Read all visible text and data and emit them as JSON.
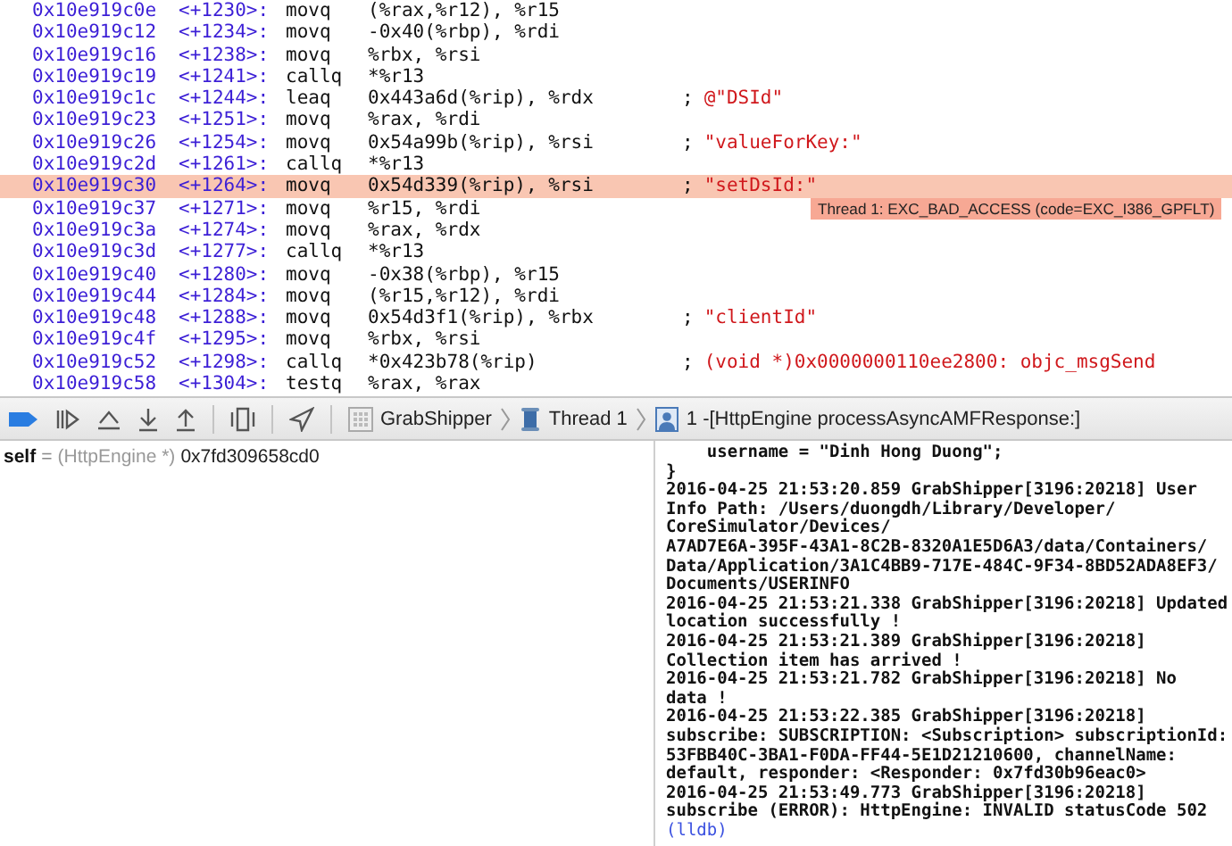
{
  "disassembly": {
    "rows": [
      {
        "address": "0x10e919c0e",
        "offset": "<+1230>:",
        "mnemonic": "movq",
        "operands": "(%rax,%r12), %r15",
        "current": false
      },
      {
        "address": "0x10e919c12",
        "offset": "<+1234>:",
        "mnemonic": "movq",
        "operands": "-0x40(%rbp), %rdi",
        "current": false
      },
      {
        "address": "0x10e919c16",
        "offset": "<+1238>:",
        "mnemonic": "movq",
        "operands": "%rbx, %rsi",
        "current": false
      },
      {
        "address": "0x10e919c19",
        "offset": "<+1241>:",
        "mnemonic": "callq",
        "operands": "*%r13",
        "current": false
      },
      {
        "address": "0x10e919c1c",
        "offset": "<+1244>:",
        "mnemonic": "leaq",
        "operands": "0x443a6d(%rip), %rdx",
        "comment_marker": ";",
        "comment": "@\"DSId\"",
        "current": false
      },
      {
        "address": "0x10e919c23",
        "offset": "<+1251>:",
        "mnemonic": "movq",
        "operands": "%rax, %rdi",
        "current": false
      },
      {
        "address": "0x10e919c26",
        "offset": "<+1254>:",
        "mnemonic": "movq",
        "operands": "0x54a99b(%rip), %rsi",
        "comment_marker": ";",
        "comment": "\"valueForKey:\"",
        "current": false
      },
      {
        "address": "0x10e919c2d",
        "offset": "<+1261>:",
        "mnemonic": "callq",
        "operands": "*%r13",
        "current": false
      },
      {
        "address": "0x10e919c30",
        "offset": "<+1264>:",
        "mnemonic": "movq",
        "operands": "0x54d339(%rip), %rsi",
        "comment_marker": ";",
        "comment": "\"setDsId:\"",
        "current": true,
        "crash_badge": "Thread 1: EXC_BAD_ACCESS (code=EXC_I386_GPFLT)"
      },
      {
        "address": "0x10e919c37",
        "offset": "<+1271>:",
        "mnemonic": "movq",
        "operands": "%r15, %rdi",
        "current": false
      },
      {
        "address": "0x10e919c3a",
        "offset": "<+1274>:",
        "mnemonic": "movq",
        "operands": "%rax, %rdx",
        "current": false
      },
      {
        "address": "0x10e919c3d",
        "offset": "<+1277>:",
        "mnemonic": "callq",
        "operands": "*%r13",
        "current": false
      },
      {
        "address": "0x10e919c40",
        "offset": "<+1280>:",
        "mnemonic": "movq",
        "operands": "-0x38(%rbp), %r15",
        "current": false
      },
      {
        "address": "0x10e919c44",
        "offset": "<+1284>:",
        "mnemonic": "movq",
        "operands": "(%r15,%r12), %rdi",
        "current": false
      },
      {
        "address": "0x10e919c48",
        "offset": "<+1288>:",
        "mnemonic": "movq",
        "operands": "0x54d3f1(%rip), %rbx",
        "comment_marker": ";",
        "comment": "\"clientId\"",
        "current": false
      },
      {
        "address": "0x10e919c4f",
        "offset": "<+1295>:",
        "mnemonic": "movq",
        "operands": "%rbx, %rsi",
        "current": false
      },
      {
        "address": "0x10e919c52",
        "offset": "<+1298>:",
        "mnemonic": "callq",
        "operands": "*0x423b78(%rip)",
        "comment_marker": ";",
        "comment": "(void *)0x0000000110ee2800: objc_msgSend",
        "current": false
      },
      {
        "address": "0x10e919c58",
        "offset": "<+1304>:",
        "mnemonic": "testq",
        "operands": "%rax, %rax",
        "current": false
      }
    ]
  },
  "debug_bar": {
    "breakpoints_active": true,
    "breadcrumb": [
      {
        "kind": "app",
        "label": "GrabShipper"
      },
      {
        "kind": "thread",
        "label": "Thread 1"
      },
      {
        "kind": "frame",
        "label": "1 -[HttpEngine processAsyncAMFResponse:]"
      }
    ]
  },
  "variables": [
    {
      "name": "self",
      "separator": "=",
      "type": "(HttpEngine *)",
      "value": "0x7fd309658cd0"
    }
  ],
  "console": {
    "lines": [
      {
        "kind": "output",
        "text": "    username = \"Dinh Hong Duong\";"
      },
      {
        "kind": "output",
        "text": "}"
      },
      {
        "kind": "output",
        "text": "2016-04-25 21:53:20.859 GrabShipper[3196:20218] User"
      },
      {
        "kind": "output",
        "text": "Info Path: /Users/duongdh/Library/Developer/"
      },
      {
        "kind": "output",
        "text": "CoreSimulator/Devices/"
      },
      {
        "kind": "output",
        "text": "A7AD7E6A-395F-43A1-8C2B-8320A1E5D6A3/data/Containers/"
      },
      {
        "kind": "output",
        "text": "Data/Application/3A1C4BB9-717E-484C-9F34-8BD52ADA8EF3/"
      },
      {
        "kind": "output",
        "text": "Documents/USERINFO"
      },
      {
        "kind": "output",
        "text": "2016-04-25 21:53:21.338 GrabShipper[3196:20218] Updated"
      },
      {
        "kind": "output",
        "text": "location successfully !"
      },
      {
        "kind": "output",
        "text": "2016-04-25 21:53:21.389 GrabShipper[3196:20218]"
      },
      {
        "kind": "output",
        "text": "Collection item has arrived !"
      },
      {
        "kind": "output",
        "text": "2016-04-25 21:53:21.782 GrabShipper[3196:20218] No"
      },
      {
        "kind": "output",
        "text": "data !"
      },
      {
        "kind": "output",
        "text": "2016-04-25 21:53:22.385 GrabShipper[3196:20218]"
      },
      {
        "kind": "output",
        "text": "subscribe: SUBSCRIPTION: <Subscription> subscriptionId:"
      },
      {
        "kind": "output",
        "text": "53FBB40C-3BA1-F0DA-FF44-5E1D21210600, channelName:"
      },
      {
        "kind": "output",
        "text": "default, responder: <Responder: 0x7fd30b96eac0>"
      },
      {
        "kind": "output",
        "text": "2016-04-25 21:53:49.773 GrabShipper[3196:20218]"
      },
      {
        "kind": "output",
        "text": "subscribe (ERROR): HttpEngine: INVALID statusCode 502"
      },
      {
        "kind": "prompt",
        "text": "(lldb)"
      }
    ]
  }
}
